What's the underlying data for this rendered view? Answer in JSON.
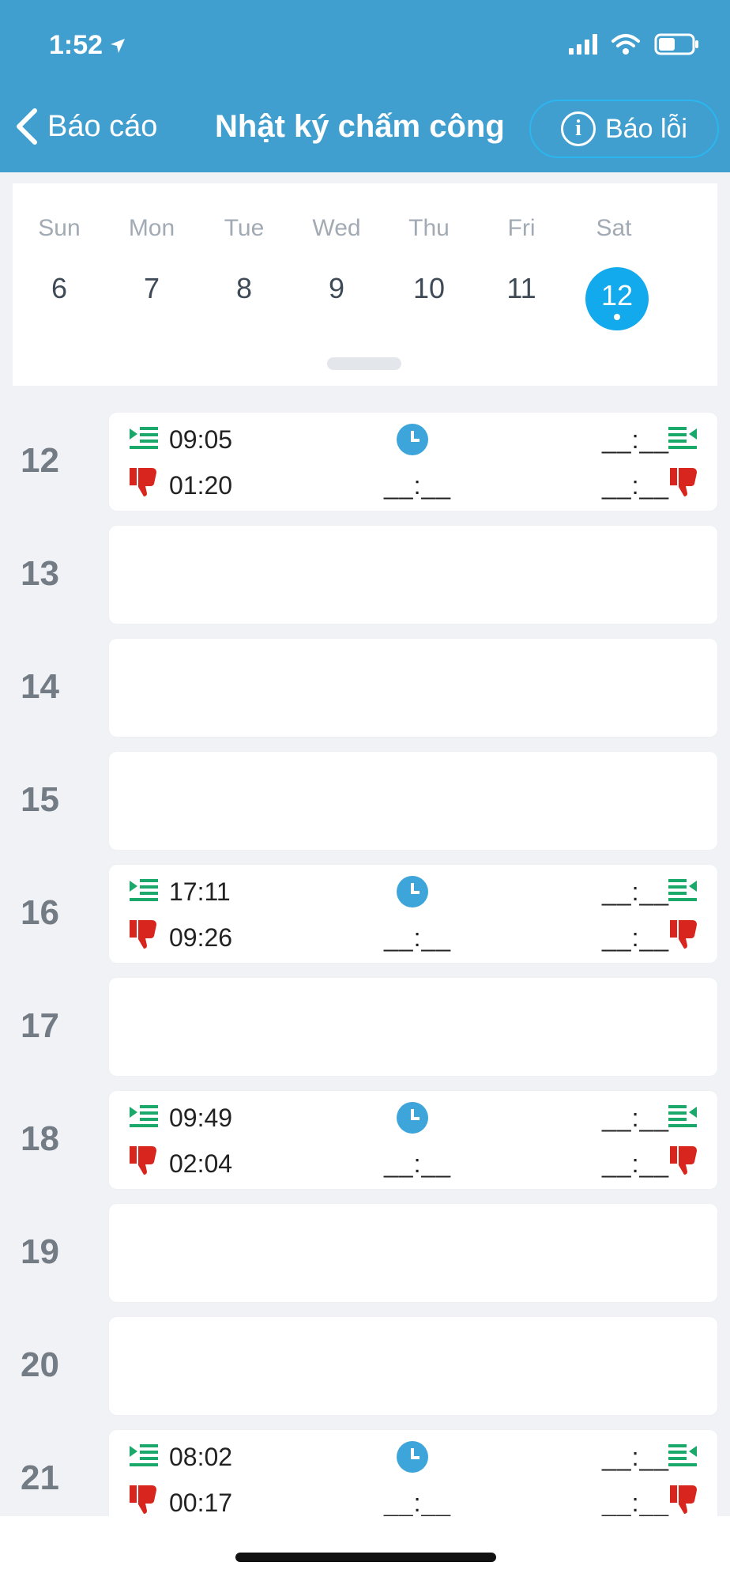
{
  "status_bar": {
    "time": "1:52"
  },
  "nav": {
    "back_label": "Báo cáo",
    "title": "Nhật ký chấm công",
    "report_label": "Báo lỗi"
  },
  "week": {
    "days": [
      {
        "name": "Sun",
        "num": "6"
      },
      {
        "name": "Mon",
        "num": "7"
      },
      {
        "name": "Tue",
        "num": "8"
      },
      {
        "name": "Wed",
        "num": "9"
      },
      {
        "name": "Thu",
        "num": "10"
      },
      {
        "name": "Fri",
        "num": "11"
      },
      {
        "name": "Sat",
        "num": "12"
      }
    ],
    "selected_index": 6
  },
  "rows": [
    {
      "day": "12",
      "check_in": "09:05",
      "late": "01:20",
      "mid": "__:__",
      "check_out": "__:__",
      "early": "__:__"
    },
    {
      "day": "13"
    },
    {
      "day": "14"
    },
    {
      "day": "15"
    },
    {
      "day": "16",
      "check_in": "17:11",
      "late": "09:26",
      "mid": "__:__",
      "check_out": "__:__",
      "early": "__:__"
    },
    {
      "day": "17"
    },
    {
      "day": "18",
      "check_in": "09:49",
      "late": "02:04",
      "mid": "__:__",
      "check_out": "__:__",
      "early": "__:__"
    },
    {
      "day": "19"
    },
    {
      "day": "20"
    },
    {
      "day": "21",
      "check_in": "08:02",
      "late": "00:17",
      "mid": "__:__",
      "check_out": "__:__",
      "early": "__:__"
    }
  ],
  "colors": {
    "header": "#419fcf",
    "selected": "#13a9ed",
    "green": "#1aa86b",
    "red": "#d8251d",
    "clock": "#3da5d9"
  }
}
